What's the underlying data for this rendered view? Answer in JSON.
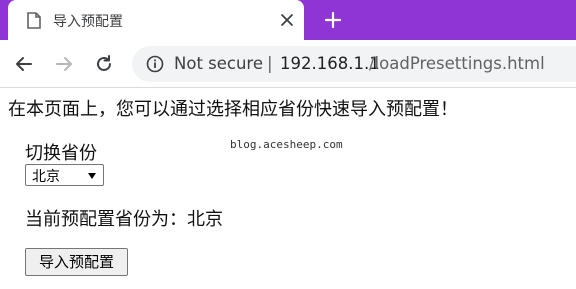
{
  "browser": {
    "tab_title": "导入预配置",
    "new_tab_symbol": "+",
    "security_label": "Not secure",
    "separator": "|",
    "url_host": "192.168.1.1",
    "url_path": "/loadPresettings.html",
    "accent_color": "#8f35d6"
  },
  "page": {
    "intro_text": "在本页面上，您可以通过选择相应省份快速导入预配置！",
    "province_label": "切换省份",
    "watermark": "blog.acesheep.com",
    "province_selected": "北京",
    "current_label": "当前预配置省份为：",
    "current_value": "北京",
    "import_button": "导入预配置"
  }
}
